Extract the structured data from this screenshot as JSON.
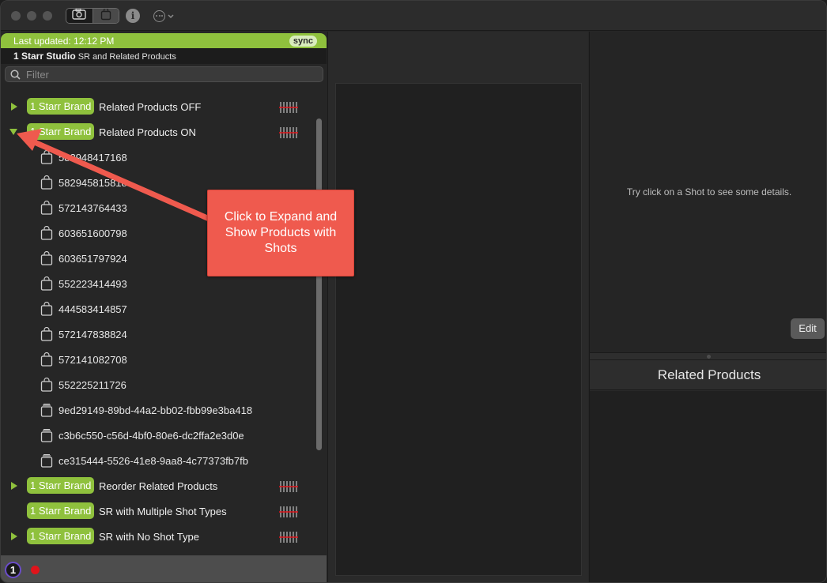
{
  "toolbar": {
    "camera_segment": "camera-icon",
    "bag_segment": "shopping-bag-icon",
    "info_label": "i",
    "more_icon": "ellipsis-circle-icon"
  },
  "status": {
    "last_updated": "Last updated: 12:12 PM",
    "sync_label": "sync",
    "studio_name": "1 Starr Studio",
    "studio_subtitle": "SR and Related Products"
  },
  "filter": {
    "placeholder": "Filter",
    "value": ""
  },
  "groups": [
    {
      "badge": "1 Starr Brand",
      "title": "Related Products OFF",
      "expanded": false
    },
    {
      "badge": "1 Starr Brand",
      "title": "Related Products ON",
      "expanded": true
    },
    {
      "badge": "1 Starr Brand",
      "title": "Reorder Related Products",
      "expanded": false
    },
    {
      "badge": "1 Starr Brand",
      "title": "SR with Multiple Shot Types",
      "expanded": false
    },
    {
      "badge": "1 Starr Brand",
      "title": "SR with No Shot Type",
      "expanded": false
    }
  ],
  "items": [
    "582948417168",
    "582945815818",
    "572143764433",
    "603651600798",
    "603651797924",
    "552223414493",
    "444583414857",
    "572147838824",
    "572141082708",
    "552225211726",
    "9ed29149-89bd-44a2-bb02-fbb99e3ba418",
    "c3b6c550-c56d-4bf0-80e6-dc2ffa2e3d0e",
    "ce315444-5526-41e8-9aa8-4c77373fb7fb"
  ],
  "details": {
    "hint": "Try click on a Shot to see some details.",
    "edit_label": "Edit"
  },
  "related": {
    "header": "Related Products"
  },
  "bottom": {
    "app_badge": "1"
  },
  "annotation": {
    "text": "Click to Expand and Show Products with Shots",
    "color": "#ef5a4e"
  },
  "colors": {
    "accent": "#8fc13d",
    "record": "#e0141b"
  }
}
